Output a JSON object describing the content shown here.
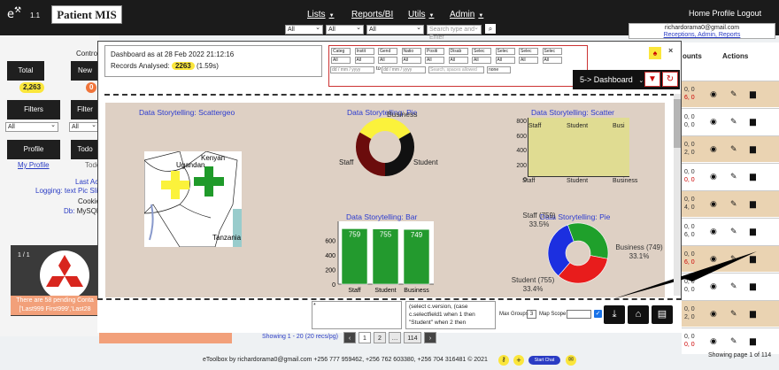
{
  "brand": {
    "letter": "e",
    "version": "1.1",
    "title": "Patient MIS"
  },
  "nav": {
    "menus": [
      "Lists",
      "Reports/BI",
      "Utils",
      "Admin"
    ],
    "right_links": [
      "Home",
      "Profile",
      "Logout"
    ],
    "selects": [
      "All",
      "All",
      "All"
    ],
    "search_placeholder": "Search type and Enter"
  },
  "user": {
    "email": "richardorama0@gmail.com",
    "roles": "Receptions, Admin, Reports"
  },
  "left": {
    "control_label": "Contro",
    "total_label": "Total",
    "total_value": "2,263",
    "new_label": "New",
    "new_value": "0",
    "filters_label": "Filters",
    "filters2_label": "Filter",
    "filter_select": "All",
    "filter2_select": "All",
    "profile_label": "Profile",
    "todo_label": "Todo",
    "my_profile": "My Profile",
    "todo_text": "Todo",
    "last_act": "Last Act",
    "logging_label": "Logging: text",
    "logging_link": "Pic Slid",
    "cookie": "Cookie",
    "db_label": "Db:",
    "db_value": "MySQL",
    "page_indicator": "1 / 1",
    "pending_text": "There are 58 pending Conta",
    "pending_links": "['Last999 First999','Last28"
  },
  "modal": {
    "dashboard_as_at": "Dashboard as at 28 Feb 2022 21:12:16",
    "records_label": "Records Analysed:",
    "records_value": "2263",
    "records_time": "(1.59s)",
    "filter_row1": [
      "Categ",
      "Instit",
      "Gend",
      "Natio",
      "Positi",
      "Disab",
      "Selec",
      "Selec",
      "Selec",
      "Selec"
    ],
    "filter_row2": [
      "All",
      "All",
      "All",
      "All",
      "All",
      "All",
      "All",
      "All",
      "All",
      "All"
    ],
    "date_placeholder": "dd / mm / yyyy",
    "to_label": "to",
    "search_placeholder": "Search, spaces allowed",
    "none_option": "none",
    "dashboard_select": "5-> Dashboard",
    "sql_text": "(select c.version, (case c.selectfield1 when 1 then \"Student\" when 2 then",
    "textarea_value": "*",
    "max_groups_label": "Max Groups",
    "max_groups_value": "3",
    "map_scope_label": "Map Scope"
  },
  "charts": {
    "geo": {
      "title": "Data Storytelling: Scattergeo",
      "labels": [
        "Ugandan",
        "Kenyan",
        "Tanzania"
      ]
    },
    "pie1": {
      "title": "Data Storytelling: Pie",
      "overlap": "Business",
      "labels": [
        "Staff",
        "Student"
      ]
    },
    "scatter": {
      "title": "Data Storytelling: Scatter",
      "yticks": [
        "800",
        "600",
        "400",
        "200",
        "0"
      ],
      "categories": [
        "Staff",
        "Student",
        "Business"
      ],
      "top_labels": [
        "Staff",
        "Student",
        "Busi"
      ]
    },
    "pie2": {
      "title": "Data Storytelling: Pie"
    }
  },
  "chart_data": [
    {
      "type": "bar",
      "title": "Data Storytelling: Bar",
      "categories": [
        "Staff",
        "Student",
        "Business"
      ],
      "values": [
        759,
        755,
        749
      ],
      "ylim": [
        0,
        800
      ],
      "yticks": [
        "600",
        "400",
        "200",
        "0"
      ]
    },
    {
      "type": "pie",
      "title": "Data Storytelling: Pie",
      "labels": [
        "Staff",
        "Student",
        "Business"
      ],
      "values": [
        759,
        755,
        749
      ],
      "percent_labels": [
        "Staff (759) 33.5%",
        "Student (755) 33.4%",
        "Business (749) 33.1%"
      ],
      "colors": [
        "#1fa02b",
        "#e81c1c",
        "#1c2fe0"
      ]
    }
  ],
  "table": {
    "headers": [
      "ounts",
      "Actions"
    ],
    "rows": [
      [
        "0, 0",
        "6, 0"
      ],
      [
        "0, 0",
        "0, 0"
      ],
      [
        "0, 0",
        "2, 0"
      ],
      [
        "0, 0",
        "0, 0"
      ],
      [
        "0, 0",
        "4, 0"
      ],
      [
        "0, 0",
        "6, 0"
      ],
      [
        "0, 0",
        "6, 0"
      ],
      [
        "0, 0",
        "0, 0"
      ],
      [
        "0, 0",
        "2, 0"
      ],
      [
        "0, 0",
        "0, 0"
      ]
    ],
    "showing": "Showing page 1 of 114"
  },
  "pagination": {
    "showing": "Showing 1 - 20 (20 recs/pg)",
    "pages": [
      "‹",
      "1",
      "2",
      "…",
      "114",
      "›"
    ]
  },
  "footer": {
    "text": "eToolbox by richardorama0@gmail.com +256 777 959462, +256 762 603380, +256 704 316481 © 2021",
    "chat": "Start Chat"
  }
}
